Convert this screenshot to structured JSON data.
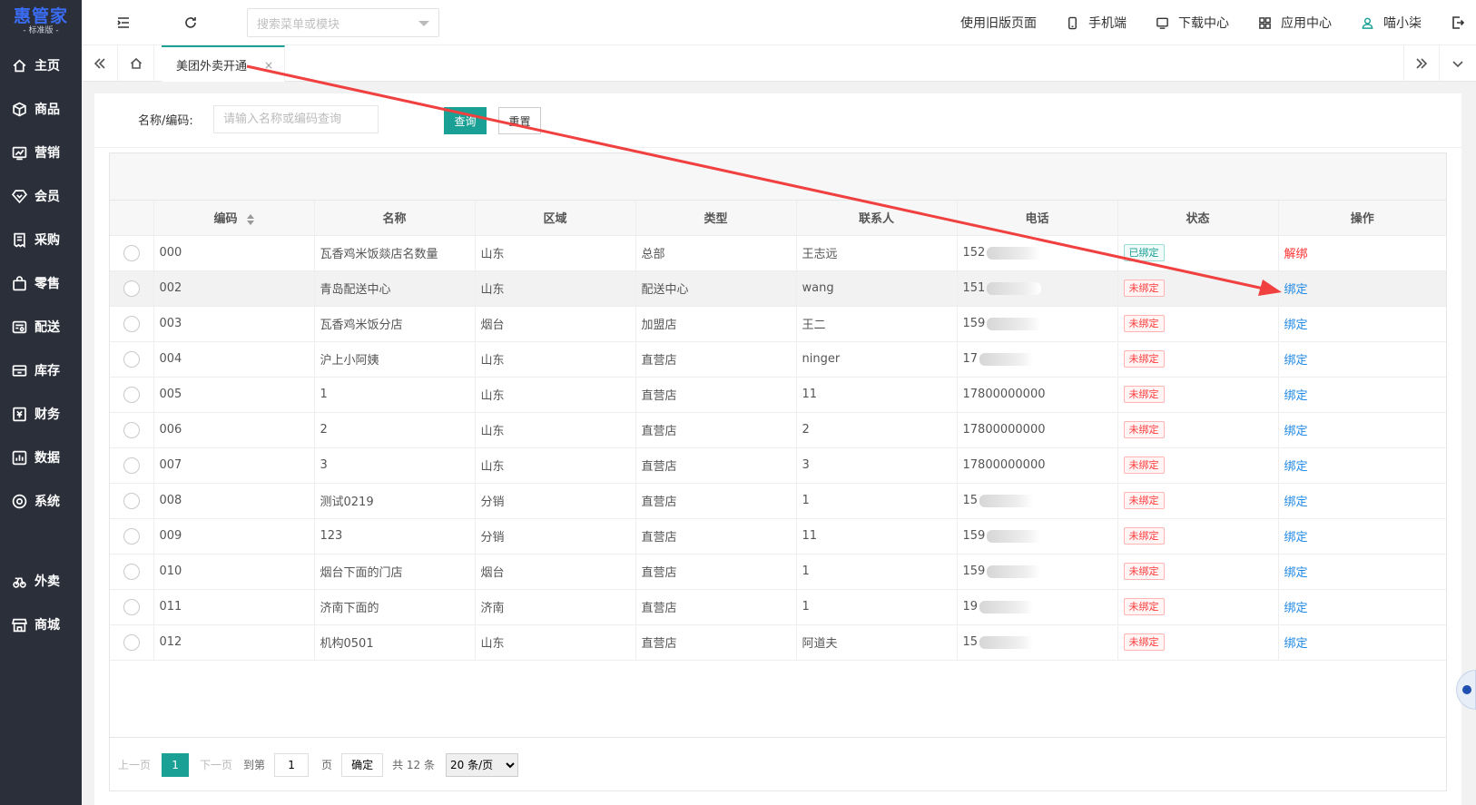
{
  "logo": {
    "title": "惠管家",
    "sub": "标准版"
  },
  "sidebar": {
    "items": [
      {
        "label": "主页",
        "icon": "home-icon"
      },
      {
        "label": "商品",
        "icon": "box-icon"
      },
      {
        "label": "营销",
        "icon": "chart-icon"
      },
      {
        "label": "会员",
        "icon": "diamond-icon"
      },
      {
        "label": "采购",
        "icon": "receipt-icon"
      },
      {
        "label": "零售",
        "icon": "bag-icon"
      },
      {
        "label": "配送",
        "icon": "truck-icon"
      },
      {
        "label": "库存",
        "icon": "inventory-icon"
      },
      {
        "label": "财务",
        "icon": "finance-icon"
      },
      {
        "label": "数据",
        "icon": "data-icon"
      },
      {
        "label": "系统",
        "icon": "settings-icon"
      }
    ],
    "extra": [
      {
        "label": "外卖",
        "icon": "takeaway-icon"
      },
      {
        "label": "商城",
        "icon": "store-icon"
      }
    ]
  },
  "header": {
    "search_placeholder": "搜索菜单或模块",
    "links": {
      "old_page": "使用旧版页面",
      "mobile": "手机端",
      "download": "下载中心",
      "apps": "应用中心",
      "user": "喵小柒"
    }
  },
  "tabs": {
    "active": "美团外卖开通",
    "close": "×"
  },
  "filter": {
    "label": "名称/编码:",
    "placeholder": "请输入名称或编码查询",
    "query": "查询",
    "reset": "重置"
  },
  "table": {
    "headers": [
      "编码",
      "名称",
      "区域",
      "类型",
      "联系人",
      "电话",
      "状态",
      "操作"
    ],
    "rows": [
      {
        "code": "000",
        "name": "瓦香鸡米饭燚店名数量",
        "region": "山东",
        "type": "总部",
        "contact": "王志远",
        "phone": "152",
        "status": "已绑定",
        "action": "解绑"
      },
      {
        "code": "002",
        "name": "青岛配送中心",
        "region": "山东",
        "type": "配送中心",
        "contact": "wang",
        "phone": "151",
        "status": "未绑定",
        "action": "绑定"
      },
      {
        "code": "003",
        "name": "瓦香鸡米饭分店",
        "region": "烟台",
        "type": "加盟店",
        "contact": "王二",
        "phone": "159",
        "status": "未绑定",
        "action": "绑定"
      },
      {
        "code": "004",
        "name": "沪上小阿姨",
        "region": "山东",
        "type": "直营店",
        "contact": "ninger",
        "phone": "17",
        "status": "未绑定",
        "action": "绑定"
      },
      {
        "code": "005",
        "name": "1",
        "region": "山东",
        "type": "直营店",
        "contact": "11",
        "phone": "17800000000",
        "status": "未绑定",
        "action": "绑定"
      },
      {
        "code": "006",
        "name": "2",
        "region": "山东",
        "type": "直营店",
        "contact": "2",
        "phone": "17800000000",
        "status": "未绑定",
        "action": "绑定"
      },
      {
        "code": "007",
        "name": "3",
        "region": "山东",
        "type": "直营店",
        "contact": "3",
        "phone": "17800000000",
        "status": "未绑定",
        "action": "绑定"
      },
      {
        "code": "008",
        "name": "测试0219",
        "region": "分销",
        "type": "直营店",
        "contact": "1",
        "phone": "15",
        "status": "未绑定",
        "action": "绑定"
      },
      {
        "code": "009",
        "name": "123",
        "region": "分销",
        "type": "直营店",
        "contact": "11",
        "phone": "159",
        "status": "未绑定",
        "action": "绑定"
      },
      {
        "code": "010",
        "name": "烟台下面的门店",
        "region": "烟台",
        "type": "直营店",
        "contact": "1",
        "phone": "159",
        "status": "未绑定",
        "action": "绑定"
      },
      {
        "code": "011",
        "name": "济南下面的",
        "region": "济南",
        "type": "直营店",
        "contact": "1",
        "phone": "19",
        "status": "未绑定",
        "action": "绑定"
      },
      {
        "code": "012",
        "name": "机构0501",
        "region": "山东",
        "type": "直营店",
        "contact": "阿道夫",
        "phone": "15",
        "status": "未绑定",
        "action": "绑定"
      }
    ]
  },
  "pager": {
    "prev": "上一页",
    "current": "1",
    "next": "下一页",
    "goto_label": "到第",
    "goto_value": "1",
    "page_unit": "页",
    "confirm": "确定",
    "total": "共 12 条",
    "per_page": "20 条/页"
  },
  "colors": {
    "accent": "#1aa094",
    "sidebar_bg": "#2b2f3a",
    "bind_link": "#1e88e5",
    "unbind_link": "#ff2e2e",
    "annotation_arrow": "#f04040"
  }
}
